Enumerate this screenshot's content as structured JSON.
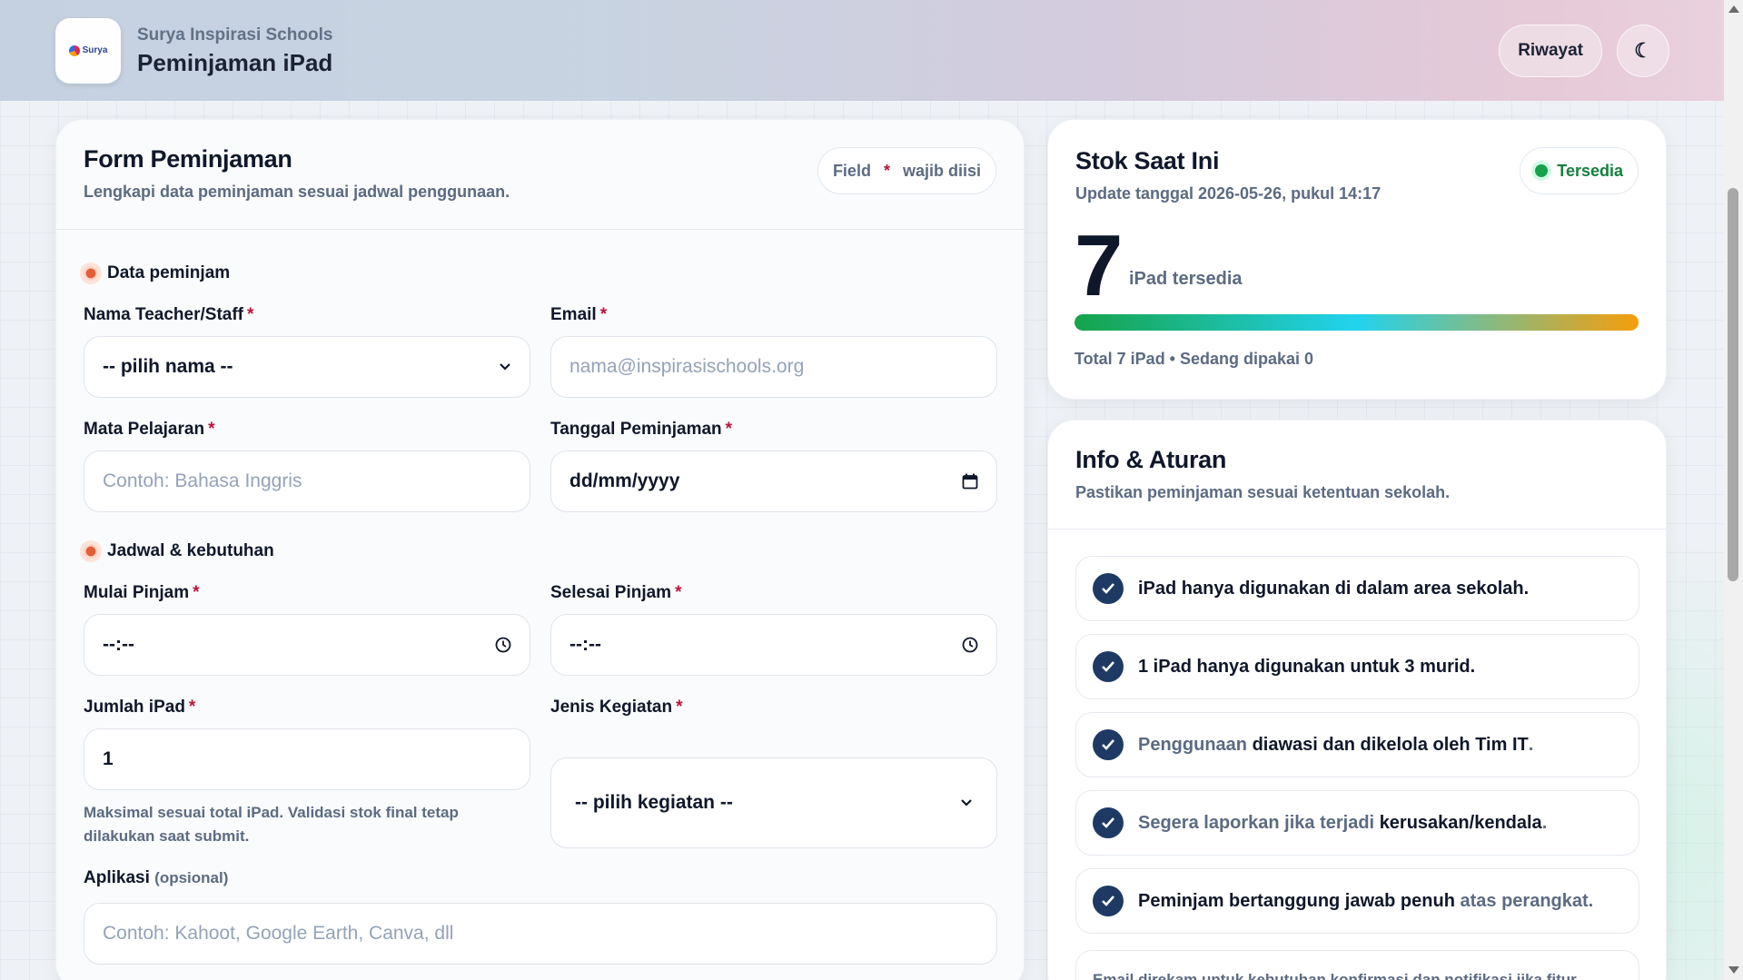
{
  "header": {
    "school_name": "Surya Inspirasi Schools",
    "app_title": "Peminjaman iPad",
    "logo_text": "Surya",
    "history_label": "Riwayat",
    "theme_icon": "☾"
  },
  "form": {
    "title": "Form Peminjaman",
    "subtitle": "Lengkapi data peminjaman sesuai jadwal penggunaan.",
    "required_note": {
      "prefix": "Field",
      "star": "*",
      "suffix": "wajib diisi"
    },
    "section_borrower": "Data peminjam",
    "section_schedule": "Jadwal & kebutuhan",
    "fields": {
      "name": {
        "label": "Nama Teacher/Staff",
        "value": "-- pilih nama --"
      },
      "email": {
        "label": "Email",
        "placeholder": "nama@inspirasischools.org"
      },
      "subject": {
        "label": "Mata Pelajaran",
        "placeholder": "Contoh: Bahasa Inggris"
      },
      "date": {
        "label": "Tanggal Peminjaman",
        "value": "dd/mm/yyyy"
      },
      "start": {
        "label": "Mulai Pinjam",
        "value": "--:--"
      },
      "end": {
        "label": "Selesai Pinjam",
        "value": "--:--"
      },
      "qty": {
        "label": "Jumlah iPad",
        "value": "1",
        "hint": "Maksimal sesuai total iPad. Validasi stok final tetap dilakukan saat submit."
      },
      "activity": {
        "label": "Jenis Kegiatan",
        "value": "-- pilih kegiatan --"
      },
      "apps": {
        "label": "Aplikasi",
        "optional": "(opsional)",
        "placeholder": "Contoh: Kahoot, Google Earth, Canva, dll"
      }
    },
    "required_star": "*"
  },
  "stock": {
    "title": "Stok Saat Ini",
    "updated": "Update tanggal 2026-05-26, pukul 14:17",
    "status": "Tersedia",
    "available": "7",
    "unit": "iPad tersedia",
    "available_fraction": 1.0,
    "footer": "Total 7 iPad • Sedang dipakai 0"
  },
  "info": {
    "title": "Info & Aturan",
    "subtitle": "Pastikan peminjaman sesuai ketentuan sekolah.",
    "rules": [
      {
        "parts": [
          {
            "text": "iPad hanya digunakan di dalam area sekolah.",
            "muted": false
          }
        ]
      },
      {
        "parts": [
          {
            "text": "1 iPad hanya digunakan untuk 3 murid.",
            "muted": false
          }
        ]
      },
      {
        "parts": [
          {
            "text": "Penggunaan ",
            "muted": true
          },
          {
            "text": "diawasi dan dikelola oleh Tim IT",
            "muted": false
          },
          {
            "text": ".",
            "muted": true
          }
        ]
      },
      {
        "parts": [
          {
            "text": "Segera laporkan jika terjadi ",
            "muted": true
          },
          {
            "text": "kerusakan/kendala",
            "muted": false
          },
          {
            "text": ".",
            "muted": true
          }
        ]
      },
      {
        "parts": [
          {
            "text": "Peminjam bertanggung jawab penuh ",
            "muted": false
          },
          {
            "text": "atas perangkat.",
            "muted": true
          }
        ]
      }
    ],
    "footnote": "Email direkam untuk kebutuhan konfirmasi dan notifikasi jika fitur"
  },
  "colors": {
    "accent": "#be123c",
    "success": "#16a34a",
    "check_bg": "#1e3a64"
  }
}
